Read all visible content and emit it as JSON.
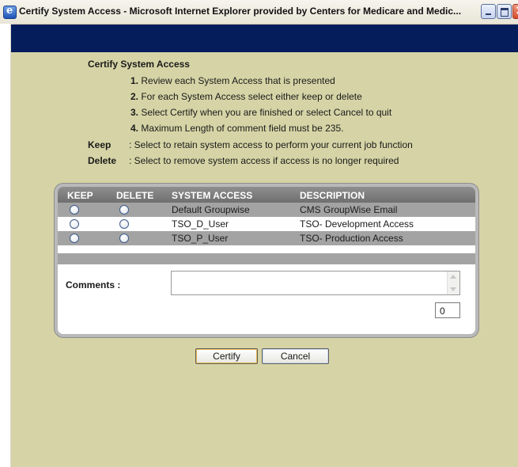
{
  "window": {
    "title": "Certify System Access - Microsoft Internet Explorer provided by Centers for Medicare and Medic..."
  },
  "instructions": {
    "title": "Certify System Access",
    "steps": [
      {
        "num": "1.",
        "text": " Review each System Access that is presented"
      },
      {
        "num": "2.",
        "text": " For each System Access select either keep or delete"
      },
      {
        "num": "3.",
        "text": " Select Certify when you are finished or select Cancel to quit"
      },
      {
        "num": "4.",
        "text": " Maximum Length of comment field must be 235."
      }
    ],
    "legend": [
      {
        "key": "Keep",
        "text": ": Select to retain system access to perform your current job function"
      },
      {
        "key": "Delete",
        "text": ": Select to remove system access if access is no longer required"
      }
    ]
  },
  "table": {
    "headers": {
      "keep": "KEEP",
      "delete": "DELETE",
      "system_access": "SYSTEM ACCESS",
      "description": "DESCRIPTION"
    },
    "rows": [
      {
        "system_access": "Default Groupwise",
        "description": "CMS GroupWise Email"
      },
      {
        "system_access": "TSO_D_User",
        "description": "TSO- Development Access"
      },
      {
        "system_access": "TSO_P_User",
        "description": "TSO- Production Access"
      }
    ]
  },
  "comments": {
    "label": "Comments :",
    "value": "",
    "count": "0"
  },
  "buttons": {
    "certify": "Certify",
    "cancel": "Cancel"
  },
  "colors": {
    "header_band": "#061d5c",
    "content_bg": "#d6d4a6",
    "table_header": "#7f7f7f",
    "row_gray": "#a3a3a3"
  }
}
